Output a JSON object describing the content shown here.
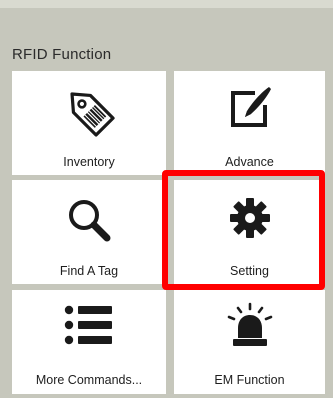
{
  "section": {
    "title": "RFID Function"
  },
  "tiles": [
    {
      "label": "Inventory",
      "icon": "tag-icon"
    },
    {
      "label": "Advance",
      "icon": "edit-note-icon"
    },
    {
      "label": "Find A Tag",
      "icon": "search-icon"
    },
    {
      "label": "Setting",
      "icon": "gear-icon"
    },
    {
      "label": "More Commands...",
      "icon": "list-icon"
    },
    {
      "label": "EM Function",
      "icon": "alarm-light-icon"
    }
  ],
  "colors": {
    "background": "#c6c7bc",
    "tile": "#ffffff",
    "highlight": "#ff0000",
    "icon": "#1a1a1a"
  }
}
